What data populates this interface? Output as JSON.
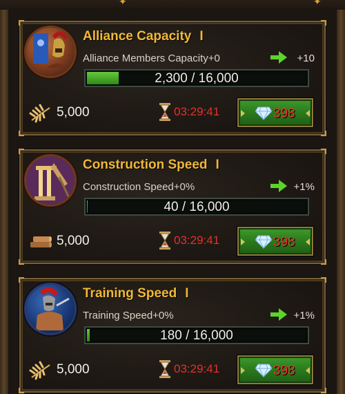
{
  "theme": {
    "title_color": "#f0b838",
    "timer_color": "#e0332a",
    "cost_color": "#e8342a",
    "bar_fill_color": "#4fb02f",
    "button_color": "#2a7a1c",
    "border_color": "#7a6136"
  },
  "cards": [
    {
      "title": "Alliance Capacity",
      "level": "I",
      "icon": "spartan-warrior-banner-icon",
      "description": "Alliance Members Capacity+0",
      "bonus": "+10",
      "progress_text": "2,300 / 16,000",
      "progress_value": 2300,
      "progress_max": 16000,
      "resource_icon": "wheat-icon",
      "resource_amount": "5,000",
      "timer": "03:29:41",
      "cost": "398",
      "cost_icon": "diamond-icon"
    },
    {
      "title": "Construction Speed",
      "level": "I",
      "icon": "construction-pillar-icon",
      "description": "Construction Speed+0%",
      "bonus": "+1%",
      "progress_text": "40 / 16,000",
      "progress_value": 40,
      "progress_max": 16000,
      "resource_icon": "wood-icon",
      "resource_amount": "5,000",
      "timer": "03:29:41",
      "cost": "398",
      "cost_icon": "diamond-icon"
    },
    {
      "title": "Training Speed",
      "level": "I",
      "icon": "gladiator-icon",
      "description": "Training Speed+0%",
      "bonus": "+1%",
      "progress_text": "180 / 16,000",
      "progress_value": 180,
      "progress_max": 16000,
      "resource_icon": "wheat-icon",
      "resource_amount": "5,000",
      "timer": "03:29:41",
      "cost": "398",
      "cost_icon": "diamond-icon"
    }
  ]
}
